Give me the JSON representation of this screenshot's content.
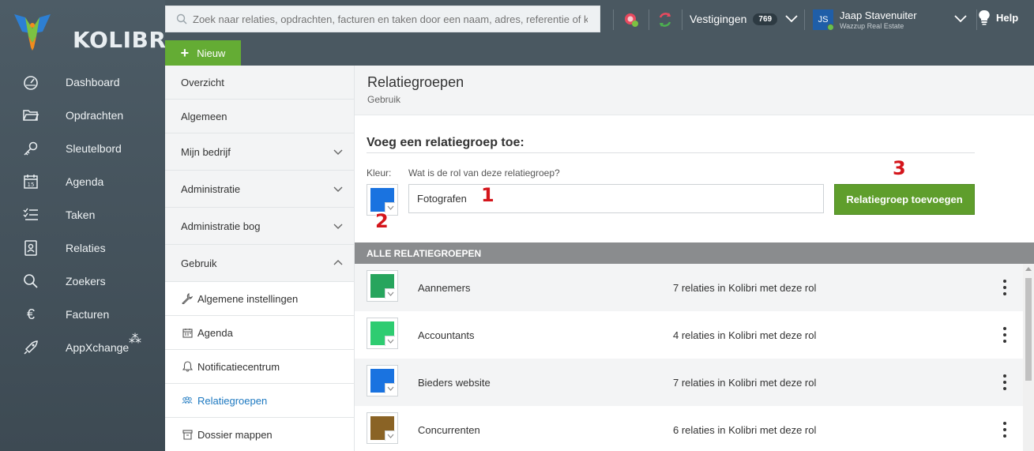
{
  "app": {
    "brand": "KOLIBRI"
  },
  "nav": {
    "items": [
      {
        "label": "Dashboard",
        "icon": "dashboard-icon"
      },
      {
        "label": "Opdrachten",
        "icon": "folder-icon"
      },
      {
        "label": "Sleutelbord",
        "icon": "key-icon"
      },
      {
        "label": "Agenda",
        "icon": "calendar-icon"
      },
      {
        "label": "Taken",
        "icon": "tasks-icon"
      },
      {
        "label": "Relaties",
        "icon": "contacts-icon"
      },
      {
        "label": "Zoekers",
        "icon": "search-icon"
      },
      {
        "label": "Facturen",
        "icon": "euro-icon"
      },
      {
        "label": "AppXchange",
        "icon": "rocket-icon"
      }
    ]
  },
  "topbar": {
    "search_placeholder": "Zoek naar relaties, opdrachten, facturen en taken door een naam, adres, referentie of kenmerk",
    "new_label": "Nieuw",
    "vestigingen_label": "Vestigingen",
    "vestigingen_count": "769",
    "user_initials": "JS",
    "user_name": "Jaap Stavenuiter",
    "user_company": "Wazzup Real Estate",
    "help_label": "Help"
  },
  "submenu": {
    "items": [
      {
        "label": "Overzicht"
      },
      {
        "label": "Algemeen"
      },
      {
        "label": "Mijn bedrijf"
      },
      {
        "label": "Administratie"
      },
      {
        "label": "Administratie bog"
      },
      {
        "label": "Gebruik"
      }
    ],
    "sub_items": [
      {
        "label": "Algemene instellingen",
        "icon": "wrench-icon"
      },
      {
        "label": "Agenda",
        "icon": "calendar-icon"
      },
      {
        "label": "Notificatiecentrum",
        "icon": "bell-icon"
      },
      {
        "label": "Relatiegroepen",
        "icon": "group-icon"
      },
      {
        "label": "Dossier mappen",
        "icon": "archive-icon"
      }
    ]
  },
  "main": {
    "title": "Relatiegroepen",
    "subtitle": "Gebruik",
    "form_title": "Voeg een relatiegroep toe:",
    "kleur_label": "Kleur:",
    "rol_label": "Wat is de rol van deze relatiegroep?",
    "rol_value": "Fotografen",
    "selected_color": "#1a73e0",
    "add_button": "Relatiegroep toevoegen",
    "callouts": [
      "1",
      "2",
      "3"
    ],
    "list_header": "ALLE RELATIEGROEPEN",
    "groups": [
      {
        "name": "Aannemers",
        "count": "7 relaties in Kolibri met deze rol",
        "color": "#27a55d"
      },
      {
        "name": "Accountants",
        "count": "4 relaties in Kolibri met deze rol",
        "color": "#2ecc71"
      },
      {
        "name": "Bieders website",
        "count": "7 relaties in Kolibri met deze rol",
        "color": "#1a73e0"
      },
      {
        "name": "Concurrenten",
        "count": "6 relaties in Kolibri met deze rol",
        "color": "#8a6325"
      }
    ]
  },
  "colors": {
    "sidebar": "#445259",
    "topbar": "#4a5861",
    "accent_green": "#64ac34",
    "active_link": "#1c78c0",
    "callout_red": "#d4151b"
  }
}
